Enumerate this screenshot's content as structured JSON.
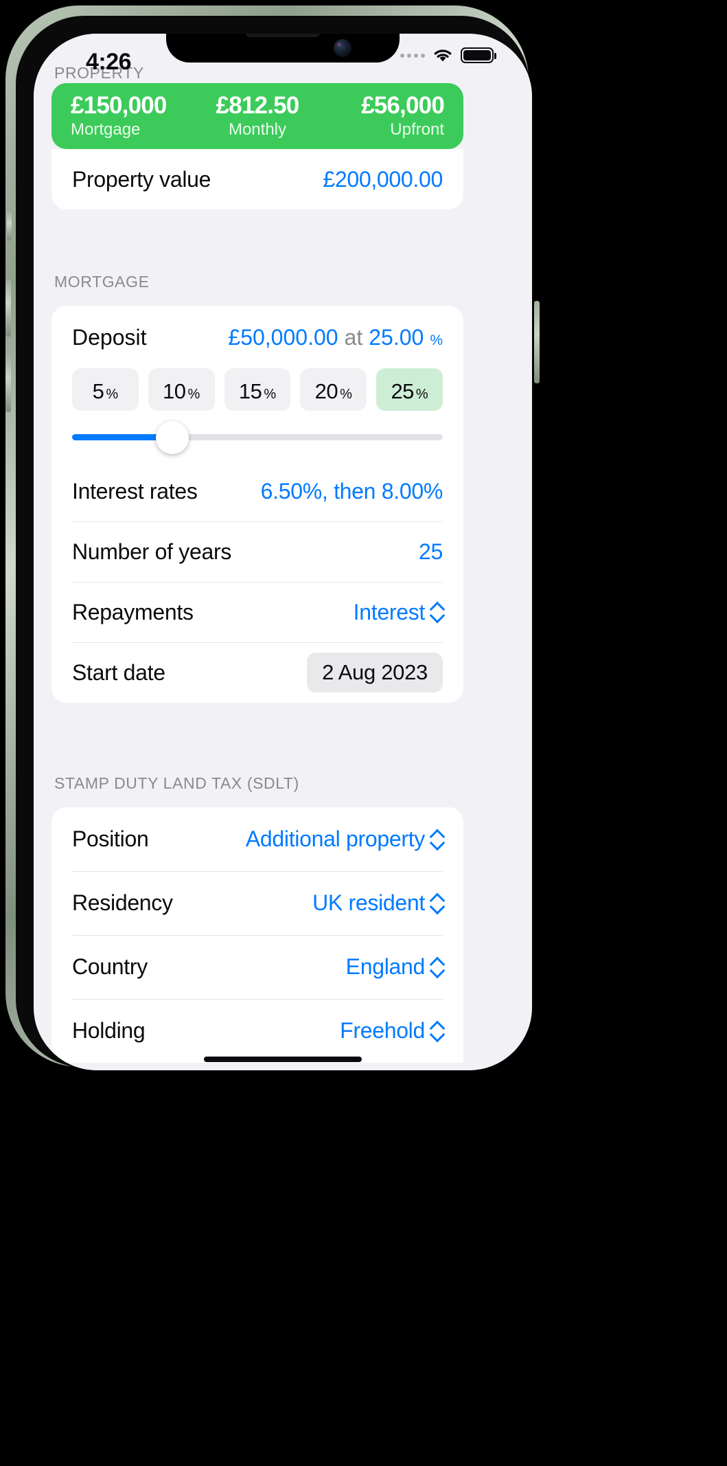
{
  "status_bar": {
    "time": "4:26",
    "wifi_icon": "wifi-icon",
    "battery_icon": "battery-full-icon"
  },
  "summary_banner": {
    "items": [
      {
        "value": "£150,000",
        "label": "Mortgage"
      },
      {
        "value": "£812.50",
        "label": "Monthly"
      },
      {
        "value": "£56,000",
        "label": "Upfront"
      }
    ],
    "color": "#3ccb5a"
  },
  "property": {
    "header": "PROPERTY",
    "rows": [
      {
        "label": "Property value",
        "value": "£200,000.00"
      }
    ]
  },
  "mortgage": {
    "header": "MORTGAGE",
    "deposit": {
      "label": "Deposit",
      "amount": "£50,000.00",
      "connector": "at",
      "percent": "25.00",
      "percent_symbol": "%",
      "chips": [
        {
          "num": "5",
          "pct": "%",
          "selected": false
        },
        {
          "num": "10",
          "pct": "%",
          "selected": false
        },
        {
          "num": "15",
          "pct": "%",
          "selected": false
        },
        {
          "num": "20",
          "pct": "%",
          "selected": false
        },
        {
          "num": "25",
          "pct": "%",
          "selected": true
        }
      ],
      "slider_percent": 27
    },
    "rows": [
      {
        "label": "Interest rates",
        "value": "6.50%, then 8.00%",
        "type": "text"
      },
      {
        "label": "Number of years",
        "value": "25",
        "type": "text"
      },
      {
        "label": "Repayments",
        "value": "Interest",
        "type": "picker"
      },
      {
        "label": "Start date",
        "value": "2 Aug 2023",
        "type": "pill"
      }
    ]
  },
  "sdlt": {
    "header": "STAMP DUTY LAND TAX (SDLT)",
    "rows": [
      {
        "label": "Position",
        "value": "Additional property",
        "type": "picker"
      },
      {
        "label": "Residency",
        "value": "UK resident",
        "type": "picker"
      },
      {
        "label": "Country",
        "value": "England",
        "type": "picker"
      },
      {
        "label": "Holding",
        "value": "Freehold",
        "type": "picker"
      }
    ]
  },
  "accent_blue": "#007aff"
}
